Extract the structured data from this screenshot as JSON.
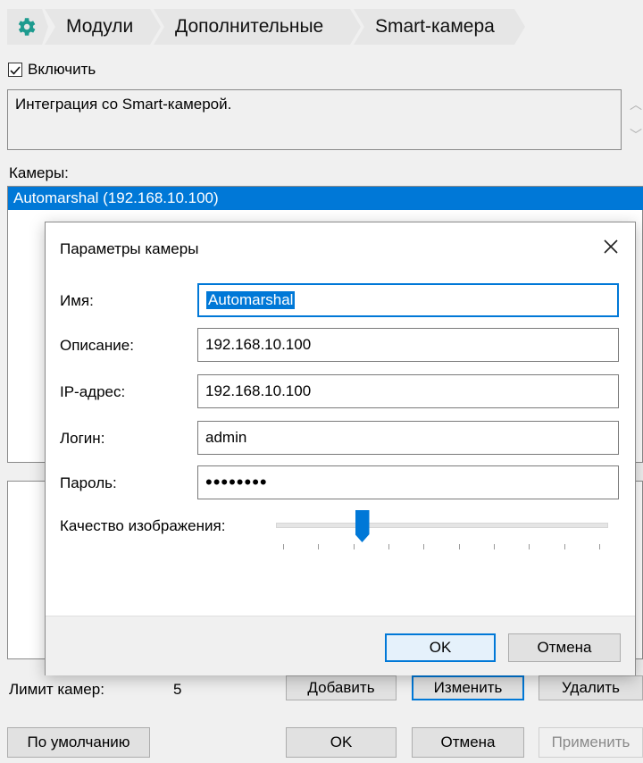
{
  "breadcrumb": {
    "items": [
      "Модули",
      "Дополнительные",
      "Smart-камера"
    ]
  },
  "enable": {
    "label": "Включить",
    "checked": true
  },
  "description": "Интеграция со Smart-камерой.",
  "cameras": {
    "label": "Камеры:",
    "items": [
      "Automarshal (192.168.10.100)"
    ]
  },
  "limit": {
    "label": "Лимит камер:",
    "value": "5"
  },
  "camera_buttons": {
    "add": "Добавить",
    "edit": "Изменить",
    "delete": "Удалить"
  },
  "footer": {
    "defaults": "По умолчанию",
    "ok": "OK",
    "cancel": "Отмена",
    "apply": "Применить"
  },
  "dialog": {
    "title": "Параметры камеры",
    "fields": {
      "name_label": "Имя:",
      "name_value": "Automarshal",
      "desc_label": "Описание:",
      "desc_value": "192.168.10.100",
      "ip_label": "IP-адрес:",
      "ip_value": "192.168.10.100",
      "login_label": "Логин:",
      "login_value": "admin",
      "password_label": "Пароль:",
      "password_value": "••••••••"
    },
    "quality": {
      "label": "Качество изображения:",
      "level_fraction": 0.25,
      "ticks": 10
    },
    "ok": "OK",
    "cancel": "Отмена"
  },
  "colors": {
    "accent": "#0078d7",
    "gear": "#1d9b8f"
  },
  "icons": {
    "gear": "gear-icon",
    "close": "close-icon",
    "check": "checkmark-icon"
  }
}
